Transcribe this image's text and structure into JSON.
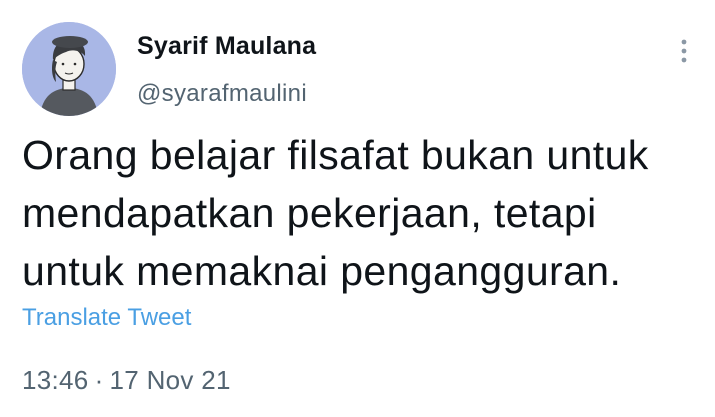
{
  "author": {
    "display_name": "Syarif Maulana",
    "handle": "@syarafmaulini"
  },
  "tweet": {
    "lines": [
      "Orang belajar filsafat bukan untuk",
      "mendapatkan pekerjaan, tetapi",
      "untuk memaknai pengangguran."
    ],
    "translate_label": "Translate Tweet",
    "time": "13:46",
    "separator": "·",
    "date": "17 Nov 21"
  },
  "icons": {
    "more": "more-vertical-icon",
    "avatar": "avatar-illustration"
  },
  "colors": {
    "text": "#0f1419",
    "secondary": "#536471",
    "link": "#4a9fe3",
    "avatar_bg": "#a9b7e6"
  }
}
